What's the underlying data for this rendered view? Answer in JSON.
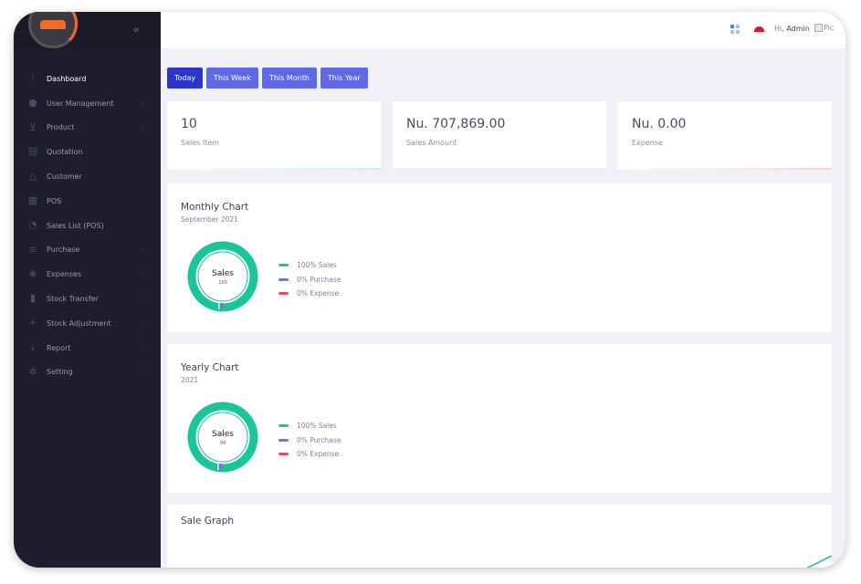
{
  "sidebar": {
    "collapse_icon": "double-chevron-left-icon",
    "items": [
      {
        "label": "Dashboard",
        "icon": "sliders-icon",
        "active": true,
        "chevron": false
      },
      {
        "label": "User Management",
        "icon": "users-icon",
        "active": false,
        "chevron": true
      },
      {
        "label": "Product",
        "icon": "cart-icon",
        "active": false,
        "chevron": true
      },
      {
        "label": "Quotation",
        "icon": "document-icon",
        "active": false,
        "chevron": false
      },
      {
        "label": "Customer",
        "icon": "warning-icon",
        "active": false,
        "chevron": false
      },
      {
        "label": "POS",
        "icon": "grid-icon",
        "active": false,
        "chevron": false
      },
      {
        "label": "Sales List (POS)",
        "icon": "clock-icon",
        "active": false,
        "chevron": false
      },
      {
        "label": "Purchase",
        "icon": "layers-icon",
        "active": false,
        "chevron": true
      },
      {
        "label": "Expenses",
        "icon": "wallet-icon",
        "active": false,
        "chevron": true
      },
      {
        "label": "Stock Transfer",
        "icon": "bar-chart-icon",
        "active": false,
        "chevron": true
      },
      {
        "label": "Stock Adjustment",
        "icon": "plus-icon",
        "active": false,
        "chevron": true
      },
      {
        "label": "Report",
        "icon": "download-icon",
        "active": false,
        "chevron": true
      },
      {
        "label": "Setting",
        "icon": "gear-icon",
        "active": false,
        "chevron": true
      }
    ]
  },
  "topbar": {
    "greeting": "Hi,",
    "user": "Admin",
    "pic_alt": "Pic"
  },
  "filters": [
    {
      "label": "Today",
      "active": true
    },
    {
      "label": "This Week",
      "active": false
    },
    {
      "label": "This Month",
      "active": false
    },
    {
      "label": "This Year",
      "active": false
    }
  ],
  "stats": [
    {
      "value": "10",
      "label": "Sales Item",
      "accent": "#1bc5bd"
    },
    {
      "value": "Nu. 707,869.00",
      "label": "Sales Amount",
      "accent": "#e8e8f0"
    },
    {
      "value": "Nu. 0.00",
      "label": "Expense",
      "accent": "#f64e92"
    }
  ],
  "monthly_chart": {
    "title": "Monthly Chart",
    "subtitle": "September 2021",
    "center_label": "Sales",
    "center_value": "100",
    "legend": [
      "100% Sales",
      "0% Purchase",
      "0% Expense"
    ]
  },
  "yearly_chart": {
    "title": "Yearly Chart",
    "subtitle": "2021",
    "center_label": "Sales",
    "center_value": "99",
    "legend": [
      "100% Sales",
      "0% Purchase",
      "0% Expense"
    ]
  },
  "sale_graph": {
    "title": "Sale Graph"
  },
  "colors": {
    "sales": "#1bc59a",
    "purchase": "#5a7cf2",
    "expense": "#f2447e",
    "sidebar_bg": "#1e1e2d",
    "button": "#6069e6",
    "button_active": "#2c35c9"
  }
}
